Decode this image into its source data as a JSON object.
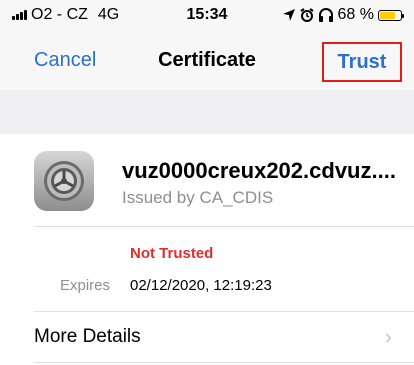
{
  "status_bar": {
    "carrier": "O2 - CZ",
    "network": "4G",
    "time": "15:34",
    "battery": "68 %",
    "battery_level": 0.68
  },
  "nav": {
    "cancel_label": "Cancel",
    "title": "Certificate",
    "trust_label": "Trust"
  },
  "certificate": {
    "name": "vuz0000creux202.cdvuz....",
    "issuer": "Issued by CA_CDIS",
    "status": "Not Trusted",
    "expires_label": "Expires",
    "expires_value": "02/12/2020, 12:19:23"
  },
  "details": {
    "more_label": "More Details",
    "chevron": "›"
  },
  "colors": {
    "accent": "#2c6fd1",
    "status_red": "#e52b2b",
    "highlight_border": "#e41b1b",
    "secondary_text": "#8e8e93",
    "battery_fill": "#ffcc00"
  },
  "icons": [
    "signal-bars-icon",
    "location-arrow-icon",
    "alarm-icon",
    "headphones-icon",
    "battery-icon",
    "settings-gear-icon",
    "chevron-right-icon"
  ]
}
